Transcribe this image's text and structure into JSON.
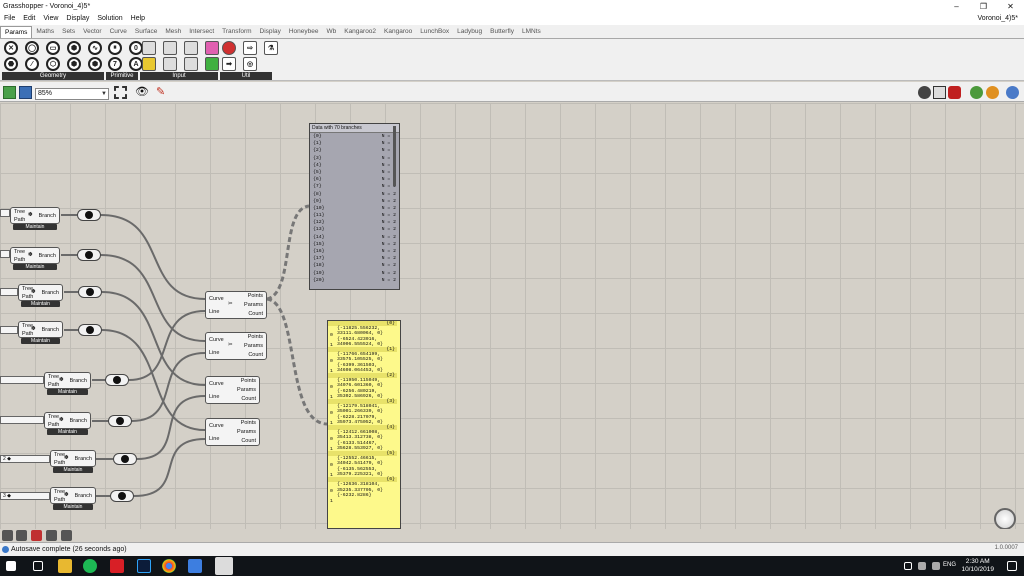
{
  "window": {
    "title": "Grasshopper - Voronoi_4)5*",
    "document_name": "Voronoi_4)5*"
  },
  "menu": [
    "File",
    "Edit",
    "View",
    "Display",
    "Solution",
    "Help"
  ],
  "tabs": [
    "Params",
    "Maths",
    "Sets",
    "Vector",
    "Curve",
    "Surface",
    "Mesh",
    "Intersect",
    "Transform",
    "Display",
    "Honeybee",
    "Wb",
    "Kangaroo2",
    "Kangaroo",
    "LunchBox",
    "Ladybug",
    "Butterfly",
    "LMNts"
  ],
  "ribbon_groups": [
    "Geometry",
    "Primitive",
    "Input",
    "Util"
  ],
  "zoom_value": "85%",
  "path_mapper": {
    "in_tree": "Tree",
    "in_path": "Path",
    "label": "Branch",
    "footer": "Maintain"
  },
  "divide": {
    "in_curve": "Curve",
    "in_line": "Line",
    "out_points": "Points",
    "out_params": "Params",
    "out_count": "Count"
  },
  "sliders": [
    "2 ◆",
    "3 ◆"
  ],
  "gray_panel": {
    "title": "Data with 70 branches",
    "rows": [
      {
        "k": "{0}",
        "v": "N = 2"
      },
      {
        "k": "{1}",
        "v": "N = 2"
      },
      {
        "k": "{2}",
        "v": "N = 2"
      },
      {
        "k": "{3}",
        "v": "N = 2"
      },
      {
        "k": "{4}",
        "v": "N = 2"
      },
      {
        "k": "{5}",
        "v": "N = 2"
      },
      {
        "k": "{6}",
        "v": "N = 2"
      },
      {
        "k": "{7}",
        "v": "N = 2"
      },
      {
        "k": "{8}",
        "v": "N = 2"
      },
      {
        "k": "{9}",
        "v": "N = 2"
      },
      {
        "k": "{10}",
        "v": "N = 2"
      },
      {
        "k": "{11}",
        "v": "N = 2"
      },
      {
        "k": "{12}",
        "v": "N = 2"
      },
      {
        "k": "{13}",
        "v": "N = 2"
      },
      {
        "k": "{14}",
        "v": "N = 2"
      },
      {
        "k": "{15}",
        "v": "N = 2"
      },
      {
        "k": "{16}",
        "v": "N = 2"
      },
      {
        "k": "{17}",
        "v": "N = 2"
      },
      {
        "k": "{18}",
        "v": "N = 2"
      },
      {
        "k": "{19}",
        "v": "N = 2"
      },
      {
        "k": "{20}",
        "v": "N = 2"
      }
    ]
  },
  "yellow_panel": {
    "blocks": [
      {
        "head": "{0}",
        "l1": "{-11825.556232,",
        "l2": "33111.680064, 0}",
        "l3": "{-6524.423016,",
        "l4": "34006.555524, 0}"
      },
      {
        "head": "{1}",
        "l1": "{-11766.654199,",
        "l2": "33575.105525, 0}",
        "l3": "{-6399.361503,",
        "l4": "34608.064453, 0}"
      },
      {
        "head": "{2}",
        "l1": "{-11950.115049,",
        "l2": "34076.601360, 0}",
        "l3": "{-6256.480219,",
        "l4": "35302.586926, 0}"
      },
      {
        "head": "{3}",
        "l1": "{-12179.518041,",
        "l2": "35001.266339, 0}",
        "l3": "{-6228.217079,",
        "l4": "35973.475052, 0}"
      },
      {
        "head": "{4}",
        "l1": "{-12412.661008,",
        "l2": "35413.312738, 0}",
        "l3": "{-6133.514467,",
        "l4": "35628.553927, 0}"
      },
      {
        "head": "{5}",
        "l1": "{-12552.46615,",
        "l2": "34042.541479, 0}",
        "l3": "{-6135.562553,",
        "l4": "35379.225321, 0}"
      },
      {
        "head": "{6}",
        "l1": "{-12636.318104,",
        "l2": "35235.337705, 0}",
        "l3": "{-6232.8286}",
        "l4": ""
      }
    ]
  },
  "status": "Autosave complete (26 seconds ago)",
  "version": "1.0.0007",
  "taskbar": {
    "lang": "ENG",
    "time": "2:30 AM",
    "date": "10/10/2019"
  }
}
